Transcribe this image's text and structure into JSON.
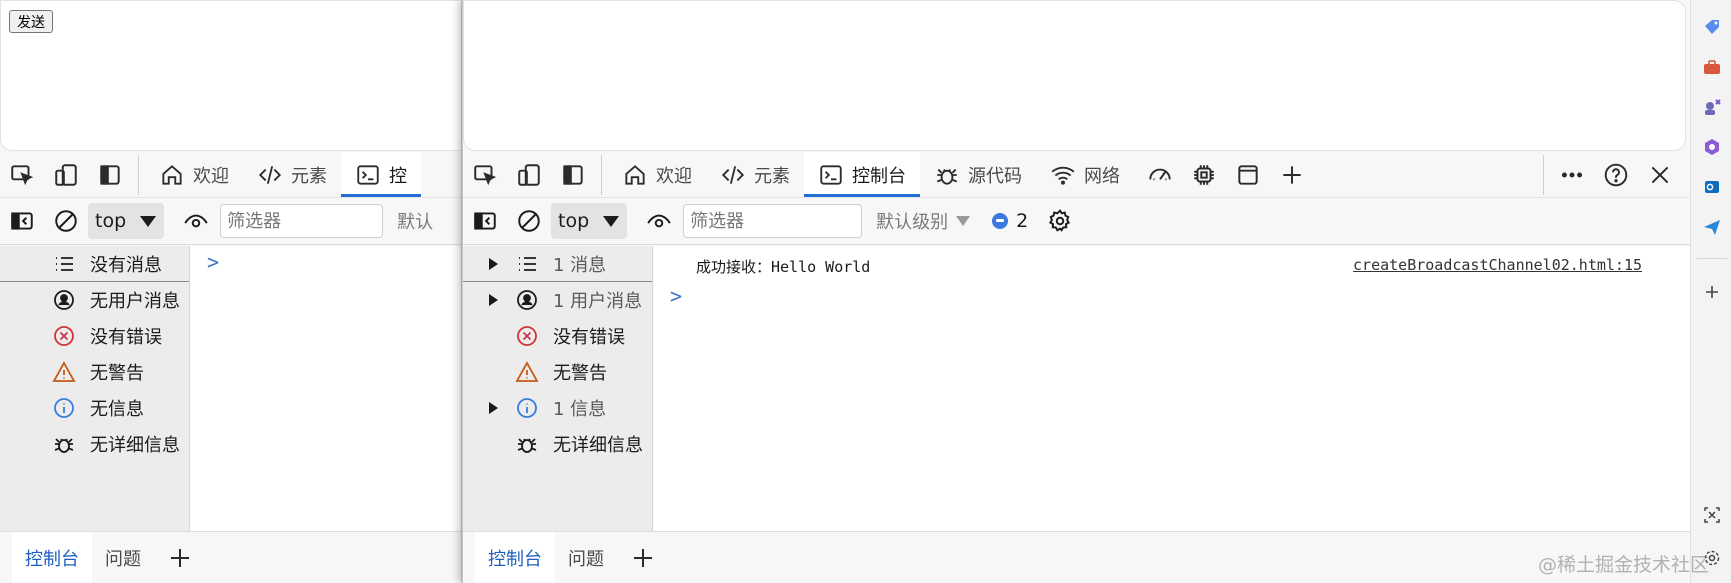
{
  "left_window": {
    "page": {
      "send_button": "发送"
    },
    "tabs": [
      {
        "label": "欢迎"
      },
      {
        "label": "元素"
      },
      {
        "label": "控"
      }
    ],
    "toolbar": {
      "context": "top",
      "filter_placeholder": "筛选器",
      "level_truncated": "默认"
    },
    "sidebar": [
      {
        "label": "没有消息"
      },
      {
        "label": "无用户消息"
      },
      {
        "label": "没有错误"
      },
      {
        "label": "无警告"
      },
      {
        "label": "无信息"
      },
      {
        "label": "无详细信息"
      }
    ],
    "drawer": {
      "tab_console": "控制台",
      "tab_issues": "问题"
    }
  },
  "right_window": {
    "tabs": [
      {
        "label": "欢迎"
      },
      {
        "label": "元素"
      },
      {
        "label": "控制台"
      },
      {
        "label": "源代码"
      },
      {
        "label": "网络"
      }
    ],
    "toolbar": {
      "context": "top",
      "filter_placeholder": "筛选器",
      "level": "默认级别",
      "issues_count": "2"
    },
    "sidebar": [
      {
        "label": "1 消息",
        "expandable": true
      },
      {
        "label": "1 用户消息",
        "expandable": true
      },
      {
        "label": "没有错误",
        "expandable": false
      },
      {
        "label": "无警告",
        "expandable": false
      },
      {
        "label": "1 信息",
        "expandable": true
      },
      {
        "label": "无详细信息",
        "expandable": false
      }
    ],
    "console": {
      "message": "成功接收：Hello World",
      "source": "createBroadcastChannel02.html:15"
    },
    "drawer": {
      "tab_console": "控制台",
      "tab_issues": "问题"
    }
  },
  "colors": {
    "accent": "#1f6fd6",
    "error": "#d13438",
    "warning": "#c55a11",
    "info": "#3a7ae0"
  },
  "watermark": "@稀土掘金技术社区"
}
